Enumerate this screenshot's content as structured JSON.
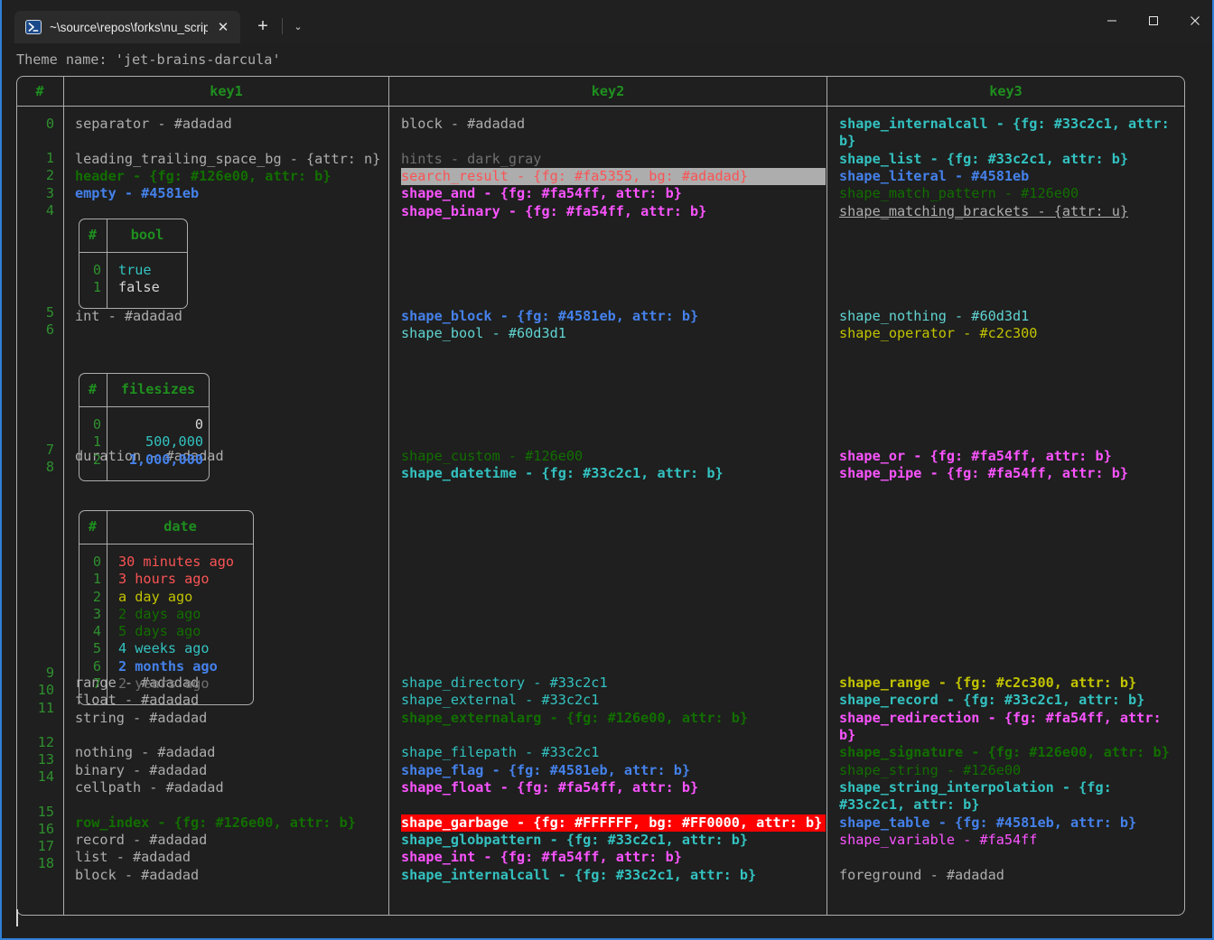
{
  "window": {
    "tab": {
      "title": "~\\source\\repos\\forks\\nu_scrip",
      "icon": "powershell-icon",
      "close_label": "✕"
    },
    "new_tab_label": "+",
    "dropdown_label": "⌄",
    "controls": {
      "minimize": "minimize-icon",
      "maximize": "maximize-icon",
      "close": "close-icon"
    },
    "accent_color": "#2f7fd6"
  },
  "terminal": {
    "theme_line": "Theme name: 'jet-brains-darcula'",
    "background": "#1e1f1e",
    "foreground": "#adadad",
    "cursor": "|"
  },
  "table": {
    "headers": [
      "#",
      "key1",
      "key2",
      "key3"
    ],
    "row_indices": [
      "0",
      "1",
      "2",
      "3",
      "4",
      "5",
      "6",
      "7",
      "8",
      "9",
      "10",
      "11",
      "12",
      "13",
      "14",
      "15",
      "16",
      "17",
      "18"
    ],
    "key1": [
      {
        "text": "separator - #adadad",
        "cls": "fg-gray"
      },
      {
        "text": "",
        "cls": "blank"
      },
      {
        "text": "leading_trailing_space_bg - {attr: n}",
        "cls": "fg-gray"
      },
      {
        "text": "header - {fg: #126e00, attr: b}",
        "cls": "fg-green b"
      },
      {
        "text": "empty - #4581eb",
        "cls": "fg-blue b"
      },
      {
        "text": "",
        "cls": "blank"
      },
      {
        "text": "",
        "cls": "blank"
      },
      {
        "text": "",
        "cls": "blank"
      },
      {
        "text": "",
        "cls": "blank"
      },
      {
        "text": "",
        "cls": "blank"
      },
      {
        "text": "",
        "cls": "blank"
      },
      {
        "text": "int - #adadad",
        "cls": "fg-gray"
      },
      {
        "text": "",
        "cls": "blank"
      },
      {
        "text": "",
        "cls": "blank"
      },
      {
        "text": "",
        "cls": "blank"
      },
      {
        "text": "",
        "cls": "blank"
      },
      {
        "text": "",
        "cls": "blank"
      },
      {
        "text": "",
        "cls": "blank"
      },
      {
        "text": "",
        "cls": "blank"
      },
      {
        "text": "duration - #adadad",
        "cls": "fg-gray"
      },
      {
        "text": "",
        "cls": "blank"
      },
      {
        "text": "",
        "cls": "blank"
      },
      {
        "text": "",
        "cls": "blank"
      },
      {
        "text": "",
        "cls": "blank"
      },
      {
        "text": "",
        "cls": "blank"
      },
      {
        "text": "",
        "cls": "blank"
      },
      {
        "text": "",
        "cls": "blank"
      },
      {
        "text": "",
        "cls": "blank"
      },
      {
        "text": "",
        "cls": "blank"
      },
      {
        "text": "",
        "cls": "blank"
      },
      {
        "text": "",
        "cls": "blank"
      },
      {
        "text": "",
        "cls": "blank"
      },
      {
        "text": "range - #adadad",
        "cls": "fg-gray"
      },
      {
        "text": "float - #adadad",
        "cls": "fg-gray"
      },
      {
        "text": "string - #adadad",
        "cls": "fg-gray"
      },
      {
        "text": "",
        "cls": "blank"
      },
      {
        "text": "nothing - #adadad",
        "cls": "fg-gray"
      },
      {
        "text": "binary - #adadad",
        "cls": "fg-gray"
      },
      {
        "text": "cellpath - #adadad",
        "cls": "fg-gray"
      },
      {
        "text": "",
        "cls": "blank"
      },
      {
        "text": "row_index - {fg: #126e00, attr: b}",
        "cls": "fg-green b"
      },
      {
        "text": "record - #adadad",
        "cls": "fg-gray"
      },
      {
        "text": "list - #adadad",
        "cls": "fg-gray"
      },
      {
        "text": "block - #adadad",
        "cls": "fg-gray"
      }
    ],
    "key2": [
      {
        "text": "block - #adadad",
        "cls": "fg-gray"
      },
      {
        "text": "",
        "cls": "blank"
      },
      {
        "text": "hints - dark_gray",
        "cls": "fg-dgray"
      },
      {
        "text": "search_result - {fg: #fa5355, bg: #adadad}",
        "cls": "hl-search"
      },
      {
        "text": "shape_and - {fg: #fa54ff, attr: b}",
        "cls": "fg-pink b"
      },
      {
        "text": "shape_binary - {fg: #fa54ff, attr: b}",
        "cls": "fg-pink b"
      },
      {
        "text": "",
        "cls": "blank"
      },
      {
        "text": "",
        "cls": "blank"
      },
      {
        "text": "",
        "cls": "blank"
      },
      {
        "text": "",
        "cls": "blank"
      },
      {
        "text": "",
        "cls": "blank"
      },
      {
        "text": "shape_block - {fg: #4581eb, attr: b}",
        "cls": "fg-blue b"
      },
      {
        "text": "shape_bool - #60d3d1",
        "cls": "fg-teal"
      },
      {
        "text": "",
        "cls": "blank"
      },
      {
        "text": "",
        "cls": "blank"
      },
      {
        "text": "",
        "cls": "blank"
      },
      {
        "text": "",
        "cls": "blank"
      },
      {
        "text": "",
        "cls": "blank"
      },
      {
        "text": "",
        "cls": "blank"
      },
      {
        "text": "shape_custom - #126e00",
        "cls": "fg-green"
      },
      {
        "text": "shape_datetime - {fg: #33c2c1, attr: b}",
        "cls": "fg-cyan b"
      },
      {
        "text": "",
        "cls": "blank"
      },
      {
        "text": "",
        "cls": "blank"
      },
      {
        "text": "",
        "cls": "blank"
      },
      {
        "text": "",
        "cls": "blank"
      },
      {
        "text": "",
        "cls": "blank"
      },
      {
        "text": "",
        "cls": "blank"
      },
      {
        "text": "",
        "cls": "blank"
      },
      {
        "text": "",
        "cls": "blank"
      },
      {
        "text": "",
        "cls": "blank"
      },
      {
        "text": "",
        "cls": "blank"
      },
      {
        "text": "",
        "cls": "blank"
      },
      {
        "text": "shape_directory - #33c2c1",
        "cls": "fg-cyan"
      },
      {
        "text": "shape_external - #33c2c1",
        "cls": "fg-cyan"
      },
      {
        "text": "shape_externalarg - {fg: #126e00, attr: b}",
        "cls": "fg-green b"
      },
      {
        "text": "",
        "cls": "blank"
      },
      {
        "text": "shape_filepath - #33c2c1",
        "cls": "fg-cyan"
      },
      {
        "text": "shape_flag - {fg: #4581eb, attr: b}",
        "cls": "fg-blue b"
      },
      {
        "text": "shape_float - {fg: #fa54ff, attr: b}",
        "cls": "fg-pink b"
      },
      {
        "text": "",
        "cls": "blank"
      },
      {
        "text": "shape_garbage - {fg: #FFFFFF, bg: #FF0000, attr: b}",
        "cls": "hl-garbage"
      },
      {
        "text": "shape_globpattern - {fg: #33c2c1, attr: b}",
        "cls": "fg-cyan b"
      },
      {
        "text": "shape_int - {fg: #fa54ff, attr: b}",
        "cls": "fg-pink b"
      },
      {
        "text": "shape_internalcall - {fg: #33c2c1, attr: b}",
        "cls": "fg-cyan b"
      }
    ],
    "key3": [
      {
        "text": "shape_internalcall - {fg: #33c2c1, attr:",
        "cls": "fg-cyan b"
      },
      {
        "text": "b}",
        "cls": "fg-cyan b"
      },
      {
        "text": "shape_list - {fg: #33c2c1, attr: b}",
        "cls": "fg-cyan b"
      },
      {
        "text": "shape_literal - #4581eb",
        "cls": "fg-blue b"
      },
      {
        "text": "shape_match_pattern - #126e00",
        "cls": "fg-green"
      },
      {
        "text": "shape_matching_brackets - {attr: u}",
        "cls": "fg-gray u"
      },
      {
        "text": "",
        "cls": "blank"
      },
      {
        "text": "",
        "cls": "blank"
      },
      {
        "text": "",
        "cls": "blank"
      },
      {
        "text": "",
        "cls": "blank"
      },
      {
        "text": "",
        "cls": "blank"
      },
      {
        "text": "shape_nothing - #60d3d1",
        "cls": "fg-teal"
      },
      {
        "text": "shape_operator - #c2c300",
        "cls": "fg-yellow"
      },
      {
        "text": "",
        "cls": "blank"
      },
      {
        "text": "",
        "cls": "blank"
      },
      {
        "text": "",
        "cls": "blank"
      },
      {
        "text": "",
        "cls": "blank"
      },
      {
        "text": "",
        "cls": "blank"
      },
      {
        "text": "",
        "cls": "blank"
      },
      {
        "text": "shape_or - {fg: #fa54ff, attr: b}",
        "cls": "fg-pink b"
      },
      {
        "text": "shape_pipe - {fg: #fa54ff, attr: b}",
        "cls": "fg-pink b"
      },
      {
        "text": "",
        "cls": "blank"
      },
      {
        "text": "",
        "cls": "blank"
      },
      {
        "text": "",
        "cls": "blank"
      },
      {
        "text": "",
        "cls": "blank"
      },
      {
        "text": "",
        "cls": "blank"
      },
      {
        "text": "",
        "cls": "blank"
      },
      {
        "text": "",
        "cls": "blank"
      },
      {
        "text": "",
        "cls": "blank"
      },
      {
        "text": "",
        "cls": "blank"
      },
      {
        "text": "",
        "cls": "blank"
      },
      {
        "text": "",
        "cls": "blank"
      },
      {
        "text": "shape_range - {fg: #c2c300, attr: b}",
        "cls": "fg-yellow b"
      },
      {
        "text": "shape_record - {fg: #33c2c1, attr: b}",
        "cls": "fg-cyan b"
      },
      {
        "text": "shape_redirection - {fg: #fa54ff, attr:",
        "cls": "fg-pink b"
      },
      {
        "text": "b}",
        "cls": "fg-pink b"
      },
      {
        "text": "shape_signature - {fg: #126e00, attr: b}",
        "cls": "fg-green b"
      },
      {
        "text": "shape_string - #126e00",
        "cls": "fg-green"
      },
      {
        "text": "shape_string_interpolation - {fg:",
        "cls": "fg-cyan b"
      },
      {
        "text": "#33c2c1, attr: b}",
        "cls": "fg-cyan b"
      },
      {
        "text": "shape_table - {fg: #4581eb, attr: b}",
        "cls": "fg-blue b"
      },
      {
        "text": "shape_variable - #fa54ff",
        "cls": "fg-pink"
      },
      {
        "text": "",
        "cls": "blank"
      },
      {
        "text": "foreground - #adadad",
        "cls": "fg-gray"
      }
    ]
  },
  "nested_tables": {
    "bool": {
      "headers": [
        "#",
        "bool"
      ],
      "rows": [
        {
          "idx": "0",
          "value": "true",
          "cls": "fg-cyan"
        },
        {
          "idx": "1",
          "value": "false",
          "cls": "fg-white"
        }
      ]
    },
    "filesizes": {
      "headers": [
        "#",
        "filesizes"
      ],
      "rows": [
        {
          "idx": "0",
          "value": "0",
          "cls": "fg-white"
        },
        {
          "idx": "1",
          "value": "500,000",
          "cls": "fg-cyan"
        },
        {
          "idx": "2",
          "value": "1,000,000",
          "cls": "fg-blue b"
        }
      ]
    },
    "date": {
      "headers": [
        "#",
        "date"
      ],
      "rows": [
        {
          "idx": "0",
          "value": "30 minutes ago",
          "cls": "fg-red"
        },
        {
          "idx": "1",
          "value": "3 hours ago",
          "cls": "fg-red"
        },
        {
          "idx": "2",
          "value": "a day ago",
          "cls": "fg-yellow"
        },
        {
          "idx": "3",
          "value": "2 days ago",
          "cls": "fg-green"
        },
        {
          "idx": "4",
          "value": "5 days ago",
          "cls": "fg-green"
        },
        {
          "idx": "5",
          "value": "4 weeks ago",
          "cls": "fg-cyan"
        },
        {
          "idx": "6",
          "value": "2 months ago",
          "cls": "fg-blue b"
        },
        {
          "idx": "7",
          "value": "2 years ago",
          "cls": "fg-dgray"
        }
      ]
    }
  }
}
